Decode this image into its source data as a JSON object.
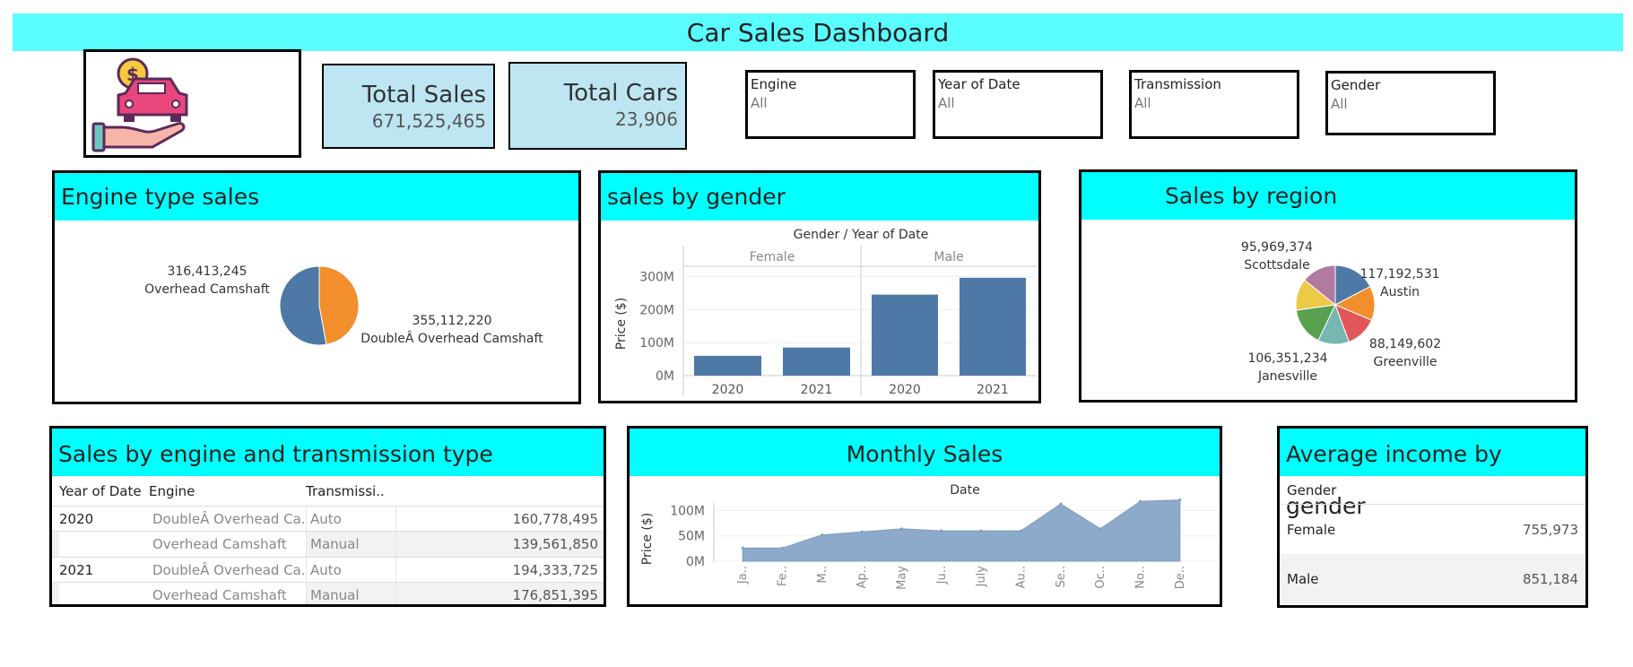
{
  "header": {
    "title": "Car Sales Dashboard"
  },
  "logo": {
    "icon": "car-money-hand-icon"
  },
  "kpis": {
    "total_sales": {
      "label": "Total Sales",
      "value": "671,525,465"
    },
    "total_cars": {
      "label": "Total Cars",
      "value": "23,906"
    }
  },
  "filters": [
    {
      "label": "Engine",
      "value": "All"
    },
    {
      "label": "Year of Date",
      "value": "All"
    },
    {
      "label": "Transmission",
      "value": "All"
    },
    {
      "label": "Gender",
      "value": "All"
    }
  ],
  "panels": {
    "engine_sales": {
      "title": "Engine type sales"
    },
    "gender_sales": {
      "title": "sales by gender"
    },
    "region_sales": {
      "title": "Sales by region"
    },
    "engine_transmission": {
      "title": "Sales by engine and transmission type"
    },
    "monthly": {
      "title": "Monthly Sales"
    },
    "income": {
      "title": "Average income by gender"
    }
  },
  "chart_data": [
    {
      "id": "engine_pie",
      "type": "pie",
      "title": "Engine type sales",
      "slices": [
        {
          "label": "Overhead Camshaft",
          "value": 316413245,
          "display": "316,413,245",
          "color": "#f28e2b"
        },
        {
          "label": "DoubleÂ Overhead Camshaft",
          "value": 355112220,
          "display": "355,112,220",
          "color": "#4e79a7"
        }
      ]
    },
    {
      "id": "gender_bar",
      "type": "bar",
      "title": "sales by gender",
      "header": "Gender  /  Year of Date",
      "ylabel": "Price ($)",
      "ylim": [
        0,
        320000000
      ],
      "yticks": [
        "0M",
        "100M",
        "200M",
        "300M"
      ],
      "ytick_values": [
        0,
        100000000,
        200000000,
        300000000
      ],
      "groups": [
        {
          "name": "Female",
          "categories": [
            "2020",
            "2021"
          ],
          "values": [
            60000000,
            85000000
          ]
        },
        {
          "name": "Male",
          "categories": [
            "2020",
            "2021"
          ],
          "values": [
            245000000,
            296000000
          ]
        }
      ],
      "color": "#4e79a7"
    },
    {
      "id": "region_pie",
      "type": "pie",
      "title": "Sales by region",
      "slices": [
        {
          "label": "Austin",
          "value": 117192531,
          "display": "117,192,531",
          "color": "#4e79a7"
        },
        {
          "label": "",
          "value": 95000000,
          "display": "",
          "color": "#f28e2b"
        },
        {
          "label": "Greenville",
          "value": 88149602,
          "display": "88,149,602",
          "color": "#e15759"
        },
        {
          "label": "",
          "value": 86000000,
          "display": "",
          "color": "#76b7b2"
        },
        {
          "label": "Janesville",
          "value": 106351234,
          "display": "106,351,234",
          "color": "#59a14f"
        },
        {
          "label": "",
          "value": 88000000,
          "display": "",
          "color": "#edc948"
        },
        {
          "label": "Scottsdale",
          "value": 95969374,
          "display": "95,969,374",
          "color": "#b07aa1"
        }
      ]
    },
    {
      "id": "engine_transmission_table",
      "type": "table",
      "columns": [
        "Year of Date",
        "Engine",
        "Transmissi..",
        ""
      ],
      "rows": [
        {
          "year": "2020",
          "engine": "DoubleÂ Overhead Ca..",
          "transmission": "Auto",
          "value": "160,778,495"
        },
        {
          "year": "",
          "engine": "Overhead Camshaft",
          "transmission": "Manual",
          "value": "139,561,850"
        },
        {
          "year": "2021",
          "engine": "DoubleÂ Overhead Ca..",
          "transmission": "Auto",
          "value": "194,333,725"
        },
        {
          "year": "",
          "engine": "Overhead Camshaft",
          "transmission": "Manual",
          "value": "176,851,395"
        }
      ]
    },
    {
      "id": "monthly_area",
      "type": "area",
      "title": "Monthly Sales",
      "header": "Date",
      "ylabel": "Price ($)",
      "ylim": [
        0,
        115000000
      ],
      "yticks": [
        "0M",
        "50M",
        "100M"
      ],
      "ytick_values": [
        0,
        50000000,
        100000000
      ],
      "x": [
        "Ja..",
        "Fe..",
        "M..",
        "Ap..",
        "May",
        "Ju..",
        "July",
        "Au..",
        "Se..",
        "Oc..",
        "No..",
        "De.."
      ],
      "values": [
        26000000,
        26000000,
        52000000,
        58000000,
        64000000,
        60000000,
        60000000,
        60000000,
        113000000,
        64000000,
        118000000,
        121000000
      ],
      "color": "#8eaacb"
    },
    {
      "id": "income_table",
      "type": "table",
      "columns": [
        "Gender",
        ""
      ],
      "rows": [
        {
          "gender": "Female",
          "value": "755,973"
        },
        {
          "gender": "Male",
          "value": "851,184"
        }
      ]
    }
  ]
}
